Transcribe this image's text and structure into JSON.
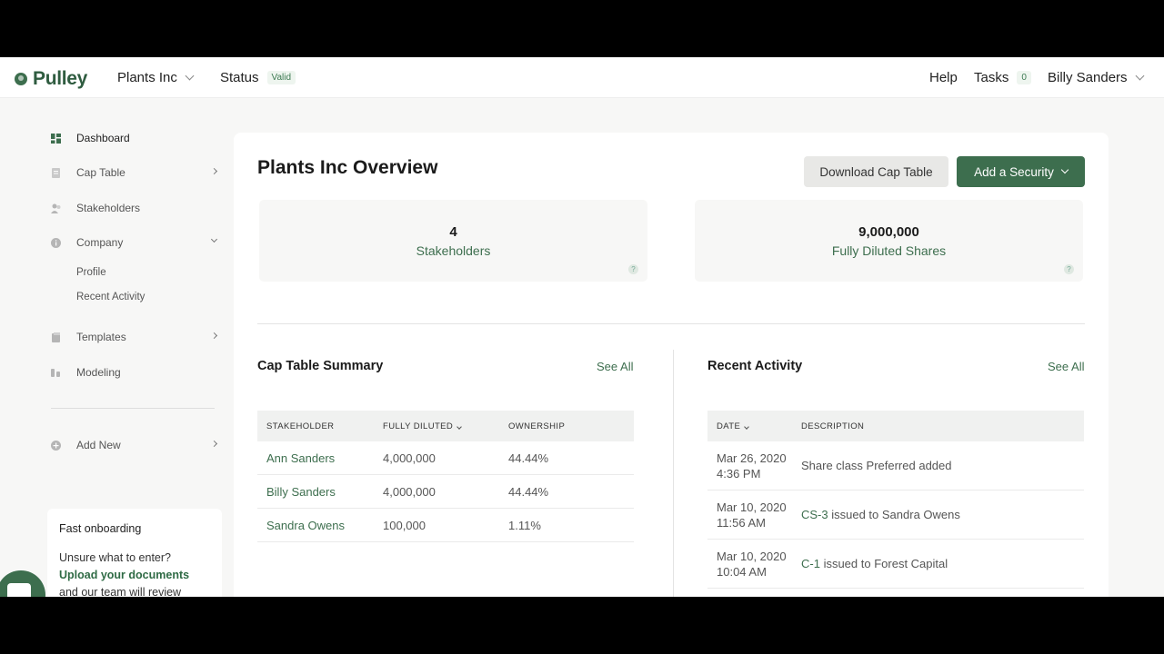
{
  "topbar": {
    "logo_text": "Pulley",
    "company": "Plants Inc",
    "status_label": "Status",
    "status_badge": "Valid",
    "help": "Help",
    "tasks_label": "Tasks",
    "tasks_count": "0",
    "user": "Billy Sanders"
  },
  "sidebar": {
    "items": [
      {
        "label": "Dashboard",
        "icon": "dashboard-icon"
      },
      {
        "label": "Cap Table",
        "icon": "document-icon"
      },
      {
        "label": "Stakeholders",
        "icon": "people-icon"
      },
      {
        "label": "Company",
        "icon": "info-icon"
      },
      {
        "label": "Templates",
        "icon": "templates-icon"
      },
      {
        "label": "Modeling",
        "icon": "modeling-icon"
      },
      {
        "label": "Add New",
        "icon": "plus-circle-icon"
      }
    ],
    "company_sub": [
      "Profile",
      "Recent Activity"
    ],
    "onboarding": {
      "title": "Fast onboarding",
      "line1": "Unsure what to enter?",
      "link": "Upload your documents",
      "line3": "and our team will review"
    }
  },
  "main": {
    "title": "Plants Inc Overview",
    "download_button": "Download Cap Table",
    "add_button": "Add a Security",
    "stats": [
      {
        "value": "4",
        "label": "Stakeholders"
      },
      {
        "value": "9,000,000",
        "label": "Fully Diluted Shares"
      }
    ],
    "cap_table": {
      "title": "Cap Table Summary",
      "see_all": "See All",
      "headers": [
        "STAKEHOLDER",
        "FULLY DILUTED",
        "OWNERSHIP"
      ],
      "rows": [
        [
          "Ann Sanders",
          "4,000,000",
          "44.44%"
        ],
        [
          "Billy Sanders",
          "4,000,000",
          "44.44%"
        ],
        [
          "Sandra Owens",
          "100,000",
          "1.11%"
        ]
      ]
    },
    "activity": {
      "title": "Recent Activity",
      "see_all": "See All",
      "headers": [
        "DATE",
        "DESCRIPTION"
      ],
      "rows": [
        {
          "date": "Mar 26, 2020",
          "time": "4:36 PM",
          "link": "",
          "desc": "Share class Preferred added"
        },
        {
          "date": "Mar 10, 2020",
          "time": "11:56 AM",
          "link": "CS-3",
          "desc": " issued to Sandra Owens"
        },
        {
          "date": "Mar 10, 2020",
          "time": "10:04 AM",
          "link": "C-1",
          "desc": " issued to Forest Capital"
        }
      ]
    }
  },
  "colors": {
    "accent": "#3d6e4e",
    "background": "#f7f7f6"
  }
}
